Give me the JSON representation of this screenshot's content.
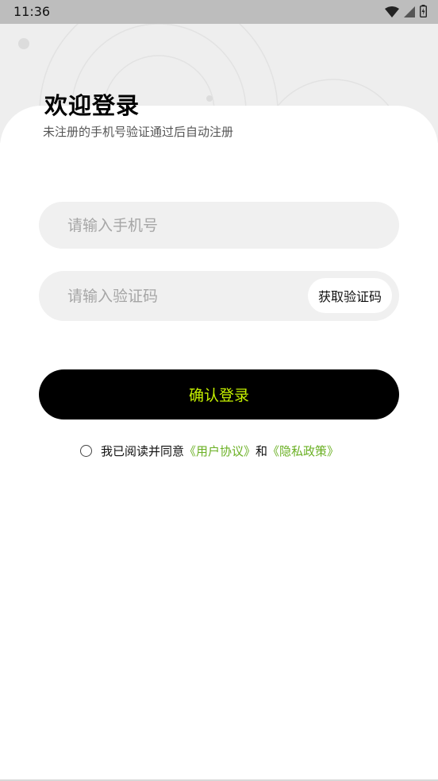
{
  "status_bar": {
    "time": "11:36"
  },
  "header": {
    "title": "欢迎登录",
    "subtitle": "未注册的手机号验证通过后自动注册"
  },
  "form": {
    "phone_placeholder": "请输入手机号",
    "code_placeholder": "请输入验证码",
    "get_code_label": "获取验证码",
    "submit_label": "确认登录"
  },
  "agreement": {
    "prefix": "我已阅读并同意",
    "user_agreement": "《用户协议》",
    "conjunction": "和",
    "privacy_policy": "《隐私政策》",
    "checked": false
  },
  "colors": {
    "accent": "#c4f000",
    "link": "#6ab023",
    "button_bg": "#000000",
    "field_bg": "#f0f0f0"
  },
  "icons": [
    "wifi-icon",
    "cellular-signal-icon",
    "battery-icon",
    "radio-unchecked-icon"
  ]
}
